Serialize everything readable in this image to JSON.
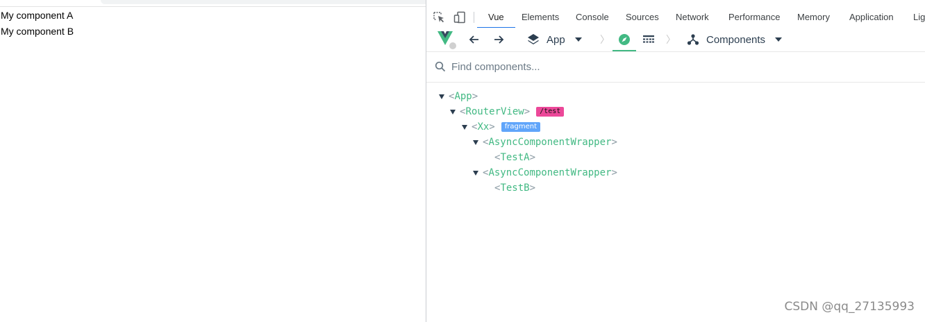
{
  "page": {
    "lines": [
      "My component A",
      "My component B"
    ]
  },
  "devtools": {
    "tabs": [
      "Vue",
      "Elements",
      "Console",
      "Sources",
      "Network",
      "Performance",
      "Memory",
      "Application",
      "Lig"
    ],
    "active_tab": "Vue",
    "toolbar": {
      "app_label": "App",
      "components_label": "Components"
    },
    "search": {
      "placeholder": "Find components..."
    },
    "tree": [
      {
        "name": "App",
        "expanded": true
      },
      {
        "name": "RouterView",
        "expanded": true,
        "badge": "/test",
        "badge_color": "#ec4899"
      },
      {
        "name": "Xx",
        "expanded": true,
        "badge": "fragment",
        "badge_color": "#60a5fa"
      },
      {
        "name": "AsyncComponentWrapper",
        "expanded": true
      },
      {
        "name": "TestA",
        "expanded": false
      },
      {
        "name": "AsyncComponentWrapper",
        "expanded": true
      },
      {
        "name": "TestB",
        "expanded": false
      }
    ]
  },
  "watermark": "CSDN @qq_27135993",
  "colors": {
    "vue_green": "#42b983",
    "accent_blue": "#1a73e8",
    "route_badge": "#ec4899",
    "fragment_badge": "#60a5fa"
  },
  "icons": [
    "inspect-element-icon",
    "device-toolbar-icon",
    "vue-logo-icon",
    "arrow-left-icon",
    "arrow-right-icon",
    "layers-icon",
    "dropdown-icon",
    "compass-icon",
    "timeline-icon",
    "components-tree-icon",
    "search-icon"
  ]
}
